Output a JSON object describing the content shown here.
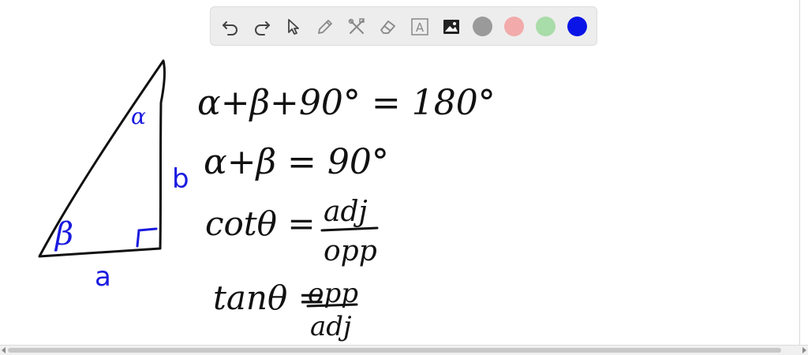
{
  "toolbar": {
    "tools": [
      {
        "name": "undo-icon"
      },
      {
        "name": "redo-icon"
      },
      {
        "name": "pointer-icon"
      },
      {
        "name": "pen-icon"
      },
      {
        "name": "tools-icon"
      },
      {
        "name": "eraser-icon"
      },
      {
        "name": "text-icon"
      },
      {
        "name": "image-icon"
      }
    ],
    "text_tool_glyph": "A",
    "colors": [
      {
        "name": "gray",
        "hex": "#9a9a9a"
      },
      {
        "name": "pink",
        "hex": "#f2aaaa"
      },
      {
        "name": "light-green",
        "hex": "#a8dca8"
      },
      {
        "name": "blue",
        "hex": "#0a14e6"
      }
    ],
    "selected_color": "blue"
  },
  "canvas": {
    "ink_black": "#111111",
    "ink_blue": "#1a1ae0",
    "triangle_labels": {
      "alpha": "α",
      "beta": "β",
      "side_a": "a",
      "side_b": "b"
    },
    "equations": [
      {
        "text": "α+β+90° = 180°"
      },
      {
        "text": "α+β = 90°"
      },
      {
        "lhs": "cotθ =",
        "numerator": "adj",
        "denominator": "opp"
      },
      {
        "lhs": "tanθ =",
        "numerator": "opp",
        "denominator": "adj"
      }
    ]
  }
}
